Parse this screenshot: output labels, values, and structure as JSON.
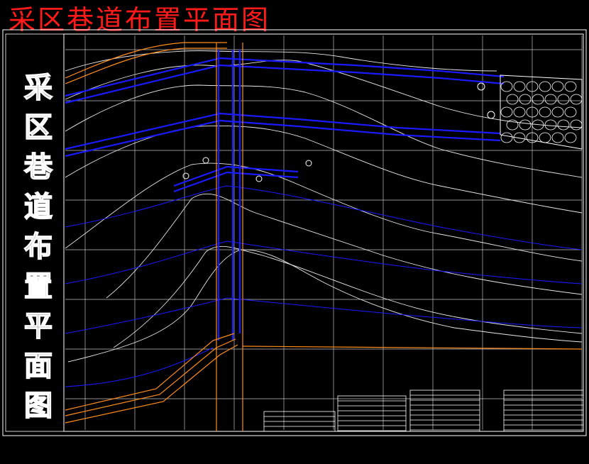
{
  "title": "采区巷道布置平面图",
  "side_title_chars": [
    "采",
    "区",
    "巷",
    "道",
    "布",
    "置",
    "平",
    "面",
    "图"
  ],
  "colors": {
    "title": "#ff1a1a",
    "background": "#000000",
    "frame": "#ffffff",
    "roadway": "#1a1aff",
    "contour": "#e8e8e8",
    "boundary": "#ff8c1a",
    "grid": "#bfbfbf"
  }
}
